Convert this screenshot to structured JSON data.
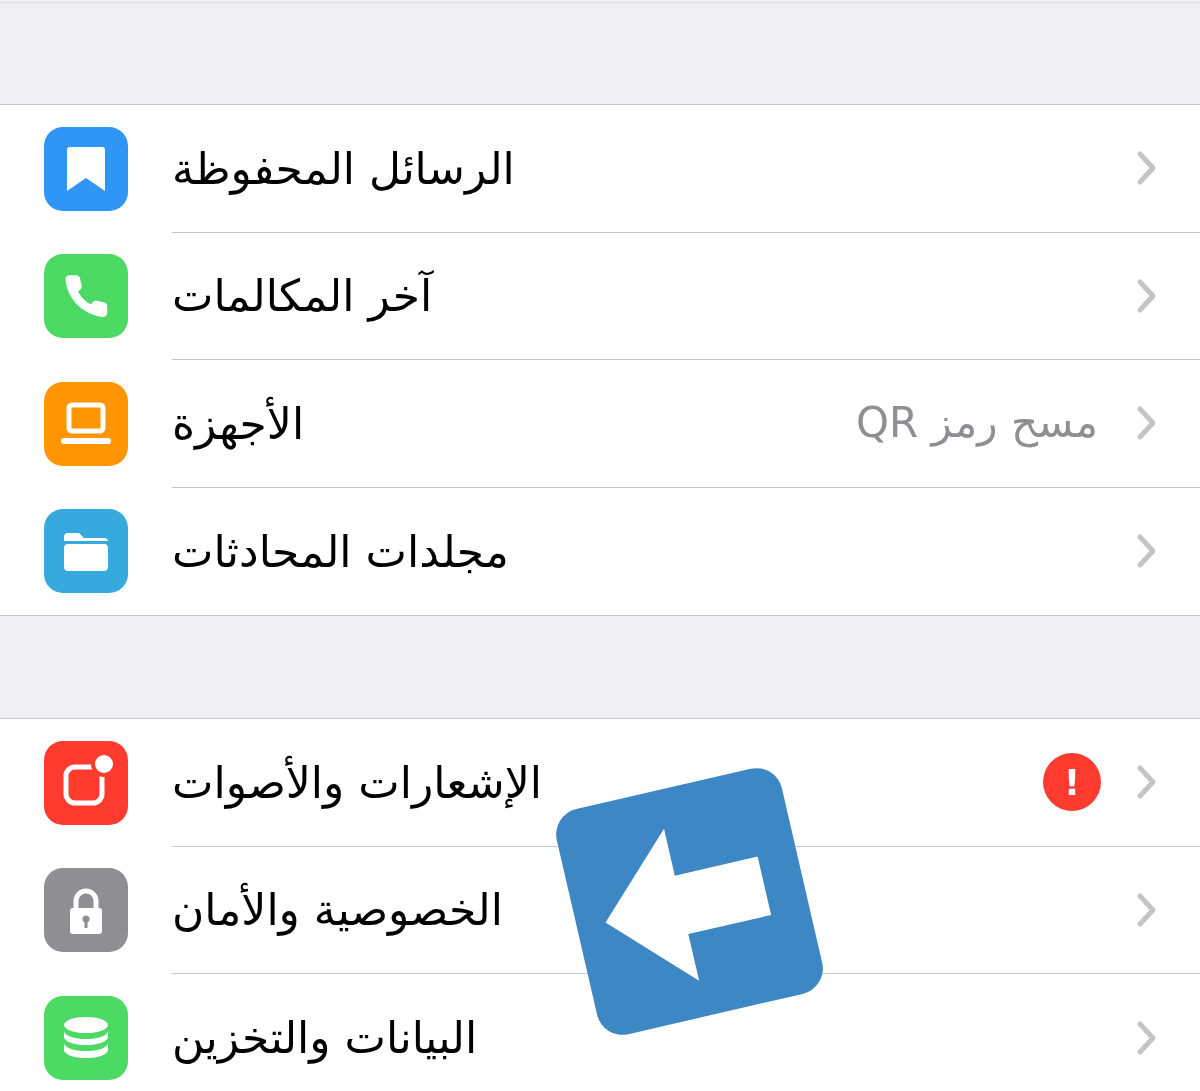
{
  "sections": [
    {
      "rows": [
        {
          "label": "الرسائل المحفوظة",
          "color": "#2f96f6"
        },
        {
          "label": "آخر المكالمات",
          "color": "#4cd964"
        },
        {
          "label": "الأجهزة",
          "value": "مسح رمز QR",
          "color": "#ff9500"
        },
        {
          "label": "مجلدات المحادثات",
          "color": "#36a9dd"
        }
      ]
    },
    {
      "rows": [
        {
          "label": "الإشعارات والأصوات",
          "badge": "!",
          "color": "#ff3b30"
        },
        {
          "label": "الخصوصية والأمان",
          "color": "#8e8e93"
        },
        {
          "label": "البيانات والتخزين",
          "color": "#4cd964"
        }
      ]
    }
  ]
}
